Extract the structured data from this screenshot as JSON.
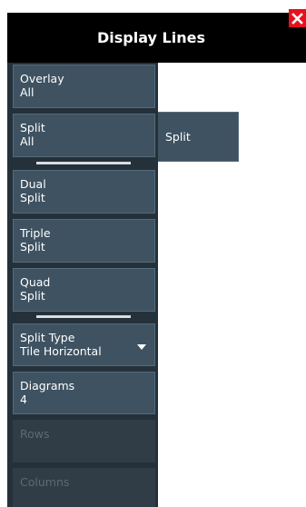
{
  "window": {
    "title": "Display Lines"
  },
  "colors": {
    "title_bar": "#000000",
    "close_button": "#e8101c",
    "panel_bg": "#25313a",
    "button_bg": "#3e5261",
    "button_border": "#566b7a",
    "disabled_text": "#5b6a76"
  },
  "menu": {
    "overlay_all": {
      "line1": "Overlay",
      "line2": "All"
    },
    "split_all": {
      "line1": "Split",
      "line2": "All"
    },
    "dual_split": {
      "line1": "Dual",
      "line2": "Split"
    },
    "triple_split": {
      "line1": "Triple",
      "line2": "Split"
    },
    "quad_split": {
      "line1": "Quad",
      "line2": "Split"
    },
    "split_type": {
      "label": "Split Type",
      "value": "Tile Horizontal"
    },
    "diagrams": {
      "label": "Diagrams",
      "value": "4"
    },
    "rows": {
      "label": "Rows"
    },
    "columns": {
      "label": "Columns"
    }
  },
  "submenu": {
    "split_label": "Split"
  },
  "icons": {
    "close": "close-icon",
    "dropdown": "chevron-down-icon"
  }
}
